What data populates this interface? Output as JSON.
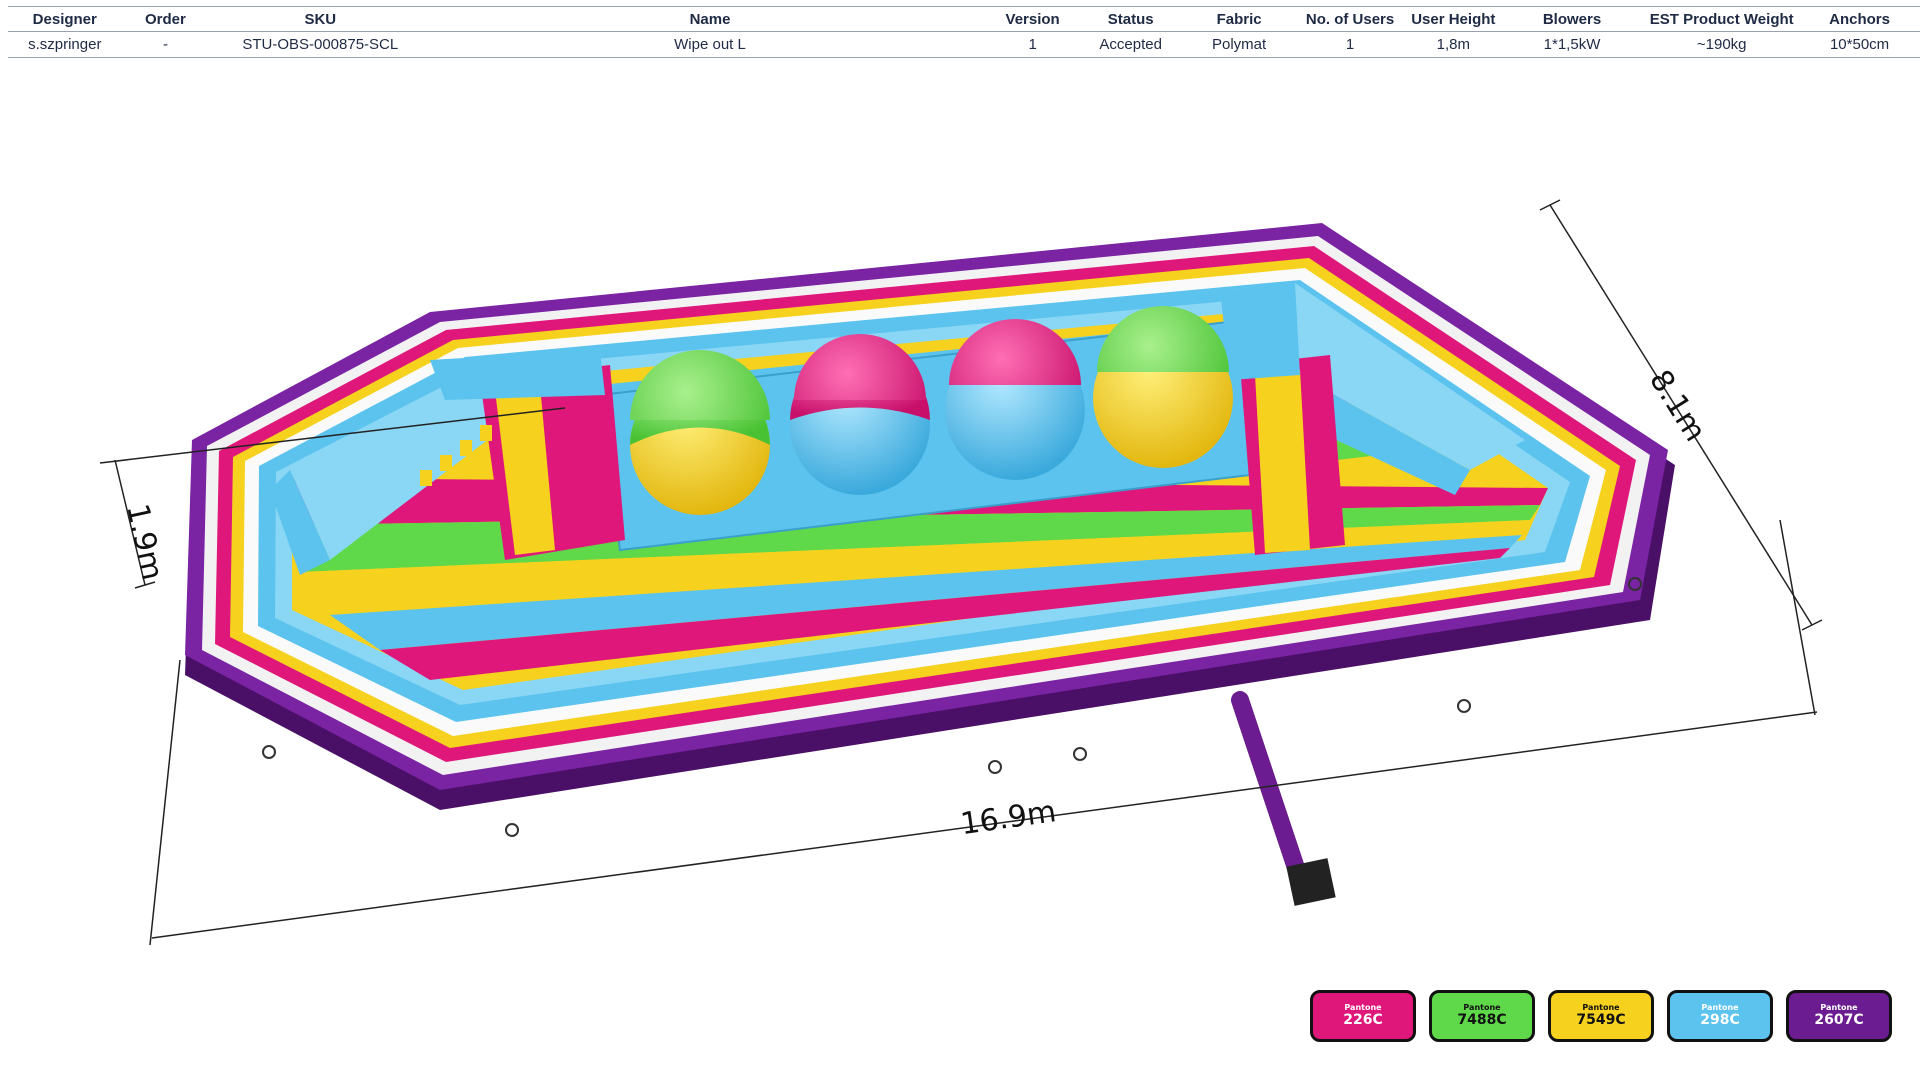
{
  "spec_table": {
    "headers": [
      "Designer",
      "Order",
      "SKU",
      "Name",
      "Version",
      "Status",
      "Fabric",
      "No. of Users",
      "User  Height",
      "Blowers",
      "EST Product Weight",
      "Anchors"
    ],
    "row": [
      "s.szpringer",
      "-",
      "STU-OBS-000875-SCL",
      "Wipe out L",
      "1",
      "Accepted",
      "Polymat",
      "1",
      "1,8m",
      "1*1,5kW",
      "~190kg",
      "10*50cm"
    ]
  },
  "dimensions": {
    "width_label": "8.1m",
    "height_label": "1.9m",
    "length_label": "16.9m"
  },
  "colors": {
    "pink": "#e0177a",
    "green": "#5fd94a",
    "yellow": "#f6d21e",
    "blue": "#5bc3ee",
    "purple": "#6c1c91"
  },
  "swatches": [
    {
      "brand": "Pantone",
      "code": "226C",
      "color": "#e0177a"
    },
    {
      "brand": "Pantone",
      "code": "7488C",
      "color": "#5fd94a"
    },
    {
      "brand": "Pantone",
      "code": "7549C",
      "color": "#f6d21e"
    },
    {
      "brand": "Pantone",
      "code": "298C",
      "color": "#5bc3ee"
    },
    {
      "brand": "Pantone",
      "code": "2607C",
      "color": "#6c1c91"
    }
  ]
}
